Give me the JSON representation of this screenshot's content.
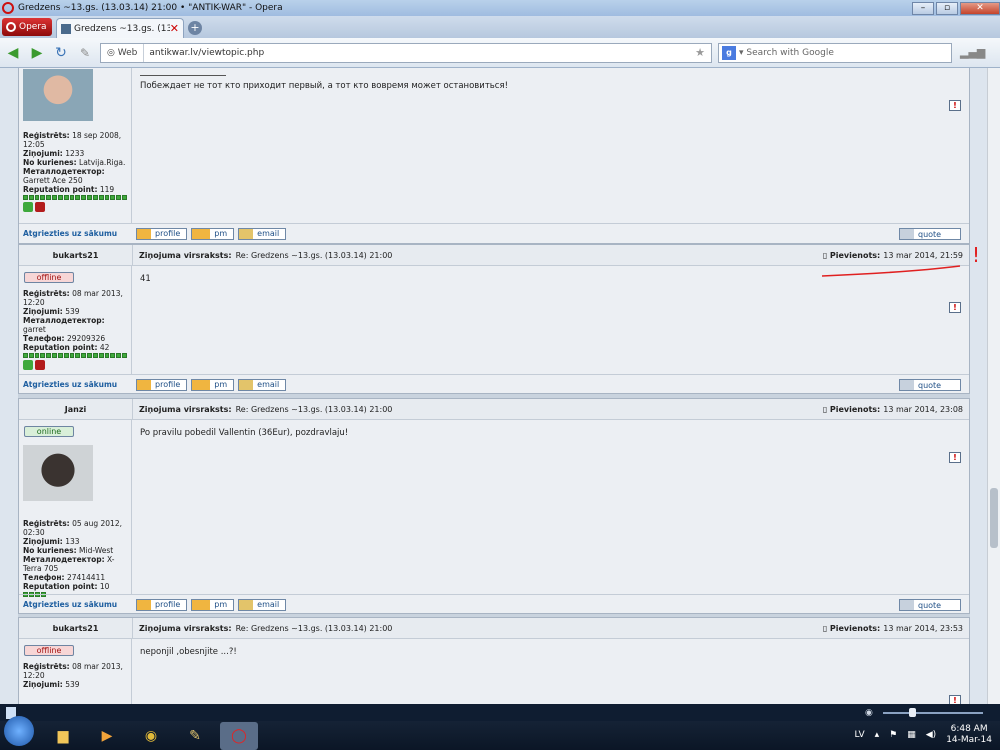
{
  "window": {
    "title": "Gredzens ~13.gs. (13.03.14) 21:00 • \"ANTIK-WAR\" - Opera"
  },
  "tabbar": {
    "menu_label": "Opera",
    "tab_title": "Gredzens ~13.gs. (13...."
  },
  "nav": {
    "web_label": "Web",
    "url": "antikwar.lv/viewtopic.php",
    "search_placeholder": "Search with Google"
  },
  "post0": {
    "signature": "Побеждает не тот кто приходит первый, а тот кто вовремя может остановиться!",
    "reg_label": "Reģistrēts:",
    "reg_value": "18 sep 2008, 12:05",
    "msgs_label": "Ziņojumi:",
    "msgs_value": "1233",
    "from_label": "No kurienes:",
    "from_value": "Latvija.Riga.",
    "detector_label": "Металлодетектор:",
    "detector_value": "Garrett Ace 250",
    "rep_label": "Reputation point:",
    "rep_value": "119"
  },
  "post1": {
    "author": "bukarts21",
    "subject_label": "Ziņojuma virsraksts:",
    "subject": "Re: Gredzens ~13.gs. (13.03.14) 21:00",
    "posted_label": "Pievienots:",
    "posted": "13 mar 2014, 21:59",
    "status": "offline",
    "message": "41",
    "reg_label": "Reģistrēts:",
    "reg_value": "08 mar 2013, 12:20",
    "msgs_label": "Ziņojumi:",
    "msgs_value": "539",
    "detector_label": "Металлодетектор:",
    "detector_value": "garret",
    "phone_label": "Телефон:",
    "phone_value": "29209326",
    "rep_label": "Reputation point:",
    "rep_value": "42"
  },
  "post2": {
    "author": "Janzi",
    "subject_label": "Ziņojuma virsraksts:",
    "subject": "Re: Gredzens ~13.gs. (13.03.14) 21:00",
    "posted_label": "Pievienots:",
    "posted": "13 mar 2014, 23:08",
    "status": "online",
    "message": "Po pravilu pobedil Vallentin (36Eur), pozdravlaju!",
    "reg_label": "Reģistrēts:",
    "reg_value": "05 aug 2012, 02:30",
    "msgs_label": "Ziņojumi:",
    "msgs_value": "133",
    "from_label": "No kurienes:",
    "from_value": "Mid-West",
    "detector_label": "Металлодетектор:",
    "detector_value": "X-Terra 705",
    "phone_label": "Телефон:",
    "phone_value": "27414411",
    "rep_label": "Reputation point:",
    "rep_value": "10"
  },
  "post3": {
    "author": "bukarts21",
    "subject_label": "Ziņojuma virsraksts:",
    "subject": "Re: Gredzens ~13.gs. (13.03.14) 21:00",
    "posted_label": "Pievienots:",
    "posted": "13 mar 2014, 23:53",
    "status": "offline",
    "message": "neponjil ,obesnjite ...?!",
    "reg_label": "Reģistrēts:",
    "reg_value": "08 mar 2013, 12:20",
    "msgs_label": "Ziņojumi:",
    "msgs_value": "539"
  },
  "buttons": {
    "back_to_top": "Atgriezties uz sākumu",
    "profile": "profile",
    "pm": "pm",
    "email": "email",
    "quote": "quote"
  },
  "annotation": {
    "mark": "!",
    "color": "#e02020"
  },
  "taskbar": {
    "language": "LV",
    "time": "6:48 AM",
    "date": "14-Mar-14"
  }
}
